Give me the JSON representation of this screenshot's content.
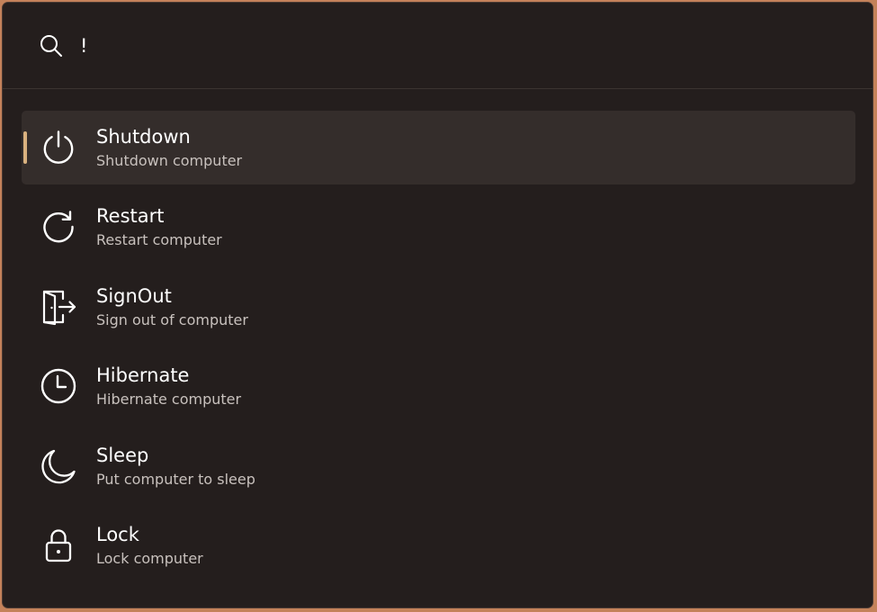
{
  "search": {
    "value": "!",
    "icon": "search-icon"
  },
  "colors": {
    "background": "#241e1d",
    "selected_row": "#342d2b",
    "accent": "#d9b17f",
    "title_text": "#ffffff",
    "subtitle_text": "#c8c1bd"
  },
  "results": [
    {
      "title": "Shutdown",
      "subtitle": "Shutdown computer",
      "icon": "power-icon",
      "selected": true
    },
    {
      "title": "Restart",
      "subtitle": "Restart computer",
      "icon": "restart-icon",
      "selected": false
    },
    {
      "title": "SignOut",
      "subtitle": "Sign out of computer",
      "icon": "sign-out-icon",
      "selected": false
    },
    {
      "title": "Hibernate",
      "subtitle": "Hibernate computer",
      "icon": "clock-icon",
      "selected": false
    },
    {
      "title": "Sleep",
      "subtitle": "Put computer to sleep",
      "icon": "moon-icon",
      "selected": false
    },
    {
      "title": "Lock",
      "subtitle": "Lock computer",
      "icon": "lock-icon",
      "selected": false
    }
  ]
}
